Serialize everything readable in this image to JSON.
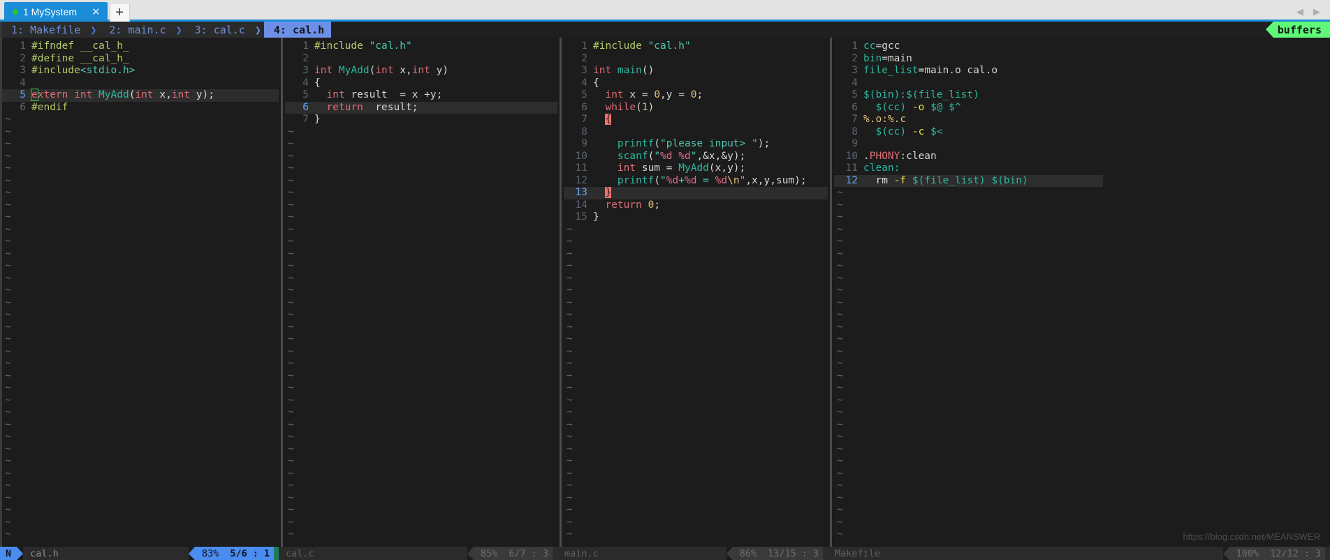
{
  "window": {
    "os_tab": {
      "label": "1 MySystem",
      "number": "1",
      "name": "MySystem",
      "status_dot": "session-active",
      "close_icon": "close-icon",
      "new_tab_icon": "plus-icon"
    },
    "scroll_left_icon": "chevron-left-icon",
    "scroll_right_icon": "chevron-right-icon",
    "accent_color": "#1a8cd8",
    "watermark": "https://blog.csdn.net/MEANSWER"
  },
  "tabline": {
    "tabs": [
      {
        "label": "1: Makefile",
        "active": false
      },
      {
        "label": "2: main.c",
        "active": false
      },
      {
        "label": "3: cal.c",
        "active": false
      },
      {
        "label": "4: cal.h",
        "active": true
      }
    ],
    "separator_glyph": "❯",
    "right_label": "buffers",
    "right_label_color": "#5ff877",
    "active_color": "#6c8fe8"
  },
  "panes": [
    {
      "name": "cal.h",
      "lines": [
        {
          "n": "1",
          "cursor": false,
          "tokens": [
            {
              "t": "#ifndef ",
              "c": "c-pre"
            },
            {
              "t": "__cal_h_",
              "c": "c-pre"
            }
          ]
        },
        {
          "n": "2",
          "cursor": false,
          "tokens": [
            {
              "t": "#define ",
              "c": "c-pre"
            },
            {
              "t": "__cal_h_",
              "c": "c-pre"
            }
          ]
        },
        {
          "n": "3",
          "cursor": false,
          "tokens": [
            {
              "t": "#include",
              "c": "c-pre"
            },
            {
              "t": "<stdio.h>",
              "c": "c-str"
            }
          ]
        },
        {
          "n": "4",
          "cursor": false,
          "tokens": []
        },
        {
          "n": "5",
          "cursor": true,
          "tokens": [
            {
              "t": "e",
              "c": "c-type cursorblk"
            },
            {
              "t": "xtern ",
              "c": "c-type"
            },
            {
              "t": "int ",
              "c": "c-type"
            },
            {
              "t": "MyAdd",
              "c": "c-fn"
            },
            {
              "t": "(",
              "c": "c-punct"
            },
            {
              "t": "int ",
              "c": "c-type"
            },
            {
              "t": "x",
              "c": "c-id"
            },
            {
              "t": ",",
              "c": "c-punct"
            },
            {
              "t": "int ",
              "c": "c-type"
            },
            {
              "t": "y",
              "c": "c-id"
            },
            {
              "t": ");",
              "c": "c-punct"
            }
          ]
        },
        {
          "n": "6",
          "cursor": false,
          "tokens": [
            {
              "t": "#endif",
              "c": "c-pre"
            }
          ]
        }
      ],
      "status": {
        "mode": "N",
        "file": "cal.h",
        "percent": "83%",
        "position": "5/6",
        "separator": ":",
        "column": "1",
        "active": true
      }
    },
    {
      "name": "cal.c",
      "lines": [
        {
          "n": "1",
          "cursor": false,
          "tokens": [
            {
              "t": "#include ",
              "c": "c-pre"
            },
            {
              "t": "\"cal.h\"",
              "c": "c-str"
            }
          ]
        },
        {
          "n": "2",
          "cursor": false,
          "tokens": []
        },
        {
          "n": "3",
          "cursor": false,
          "tokens": [
            {
              "t": "int ",
              "c": "c-type"
            },
            {
              "t": "MyAdd",
              "c": "c-fn"
            },
            {
              "t": "(",
              "c": "c-punct"
            },
            {
              "t": "int ",
              "c": "c-type"
            },
            {
              "t": "x",
              "c": "c-id"
            },
            {
              "t": ",",
              "c": "c-punct"
            },
            {
              "t": "int ",
              "c": "c-type"
            },
            {
              "t": "y",
              "c": "c-id"
            },
            {
              "t": ")",
              "c": "c-punct"
            }
          ]
        },
        {
          "n": "4",
          "cursor": false,
          "tokens": [
            {
              "t": "{",
              "c": "c-brace"
            }
          ]
        },
        {
          "n": "5",
          "cursor": false,
          "tokens": [
            {
              "t": "  ",
              "c": "c-punct"
            },
            {
              "t": "int ",
              "c": "c-type"
            },
            {
              "t": "result  = x +y;",
              "c": "c-id"
            }
          ]
        },
        {
          "n": "6",
          "cursor": true,
          "tokens": [
            {
              "t": "  ",
              "c": "c-punct"
            },
            {
              "t": "return",
              "c": "c-kw"
            },
            {
              "t": "  result;",
              "c": "c-id"
            }
          ]
        },
        {
          "n": "7",
          "cursor": false,
          "tokens": [
            {
              "t": "}",
              "c": "c-brace"
            }
          ]
        }
      ],
      "status": {
        "mode": "",
        "file": "cal.c",
        "percent": "85%",
        "position": "6/7",
        "separator": ":",
        "column": "3",
        "active": false
      }
    },
    {
      "name": "main.c",
      "lines": [
        {
          "n": "1",
          "cursor": false,
          "tokens": [
            {
              "t": "#include ",
              "c": "c-pre"
            },
            {
              "t": "\"cal.h\"",
              "c": "c-str"
            }
          ]
        },
        {
          "n": "2",
          "cursor": false,
          "tokens": []
        },
        {
          "n": "3",
          "cursor": false,
          "tokens": [
            {
              "t": "int ",
              "c": "c-type"
            },
            {
              "t": "main",
              "c": "c-fn"
            },
            {
              "t": "()",
              "c": "c-punct"
            }
          ]
        },
        {
          "n": "4",
          "cursor": false,
          "tokens": [
            {
              "t": "{",
              "c": "c-brace"
            }
          ]
        },
        {
          "n": "5",
          "cursor": false,
          "tokens": [
            {
              "t": "  ",
              "c": "c-punct"
            },
            {
              "t": "int ",
              "c": "c-type"
            },
            {
              "t": "x = ",
              "c": "c-id"
            },
            {
              "t": "0",
              "c": "c-num"
            },
            {
              "t": ",y = ",
              "c": "c-id"
            },
            {
              "t": "0",
              "c": "c-num"
            },
            {
              "t": ";",
              "c": "c-punct"
            }
          ]
        },
        {
          "n": "6",
          "cursor": false,
          "tokens": [
            {
              "t": "  ",
              "c": "c-punct"
            },
            {
              "t": "while",
              "c": "c-kw"
            },
            {
              "t": "(",
              "c": "c-punct"
            },
            {
              "t": "1",
              "c": "c-num"
            },
            {
              "t": ")",
              "c": "c-punct"
            }
          ]
        },
        {
          "n": "7",
          "cursor": false,
          "tokens": [
            {
              "t": "  ",
              "c": "c-punct"
            },
            {
              "t": "{",
              "c": "hl-paren"
            }
          ]
        },
        {
          "n": "8",
          "cursor": false,
          "tokens": []
        },
        {
          "n": "9",
          "cursor": false,
          "tokens": [
            {
              "t": "    ",
              "c": "c-punct"
            },
            {
              "t": "printf",
              "c": "c-fn"
            },
            {
              "t": "(",
              "c": "c-punct"
            },
            {
              "t": "\"please input> \"",
              "c": "c-str"
            },
            {
              "t": ");",
              "c": "c-punct"
            }
          ]
        },
        {
          "n": "10",
          "cursor": false,
          "tokens": [
            {
              "t": "    ",
              "c": "c-punct"
            },
            {
              "t": "scanf",
              "c": "c-fn"
            },
            {
              "t": "(",
              "c": "c-punct"
            },
            {
              "t": "\"",
              "c": "c-str"
            },
            {
              "t": "%d %d",
              "c": "c-fmt"
            },
            {
              "t": "\"",
              "c": "c-str"
            },
            {
              "t": ",&x,&y);",
              "c": "c-id"
            }
          ]
        },
        {
          "n": "11",
          "cursor": false,
          "tokens": [
            {
              "t": "    ",
              "c": "c-punct"
            },
            {
              "t": "int ",
              "c": "c-type"
            },
            {
              "t": "sum = ",
              "c": "c-id"
            },
            {
              "t": "MyAdd",
              "c": "c-fn"
            },
            {
              "t": "(x,y);",
              "c": "c-id"
            }
          ]
        },
        {
          "n": "12",
          "cursor": false,
          "tokens": [
            {
              "t": "    ",
              "c": "c-punct"
            },
            {
              "t": "printf",
              "c": "c-fn"
            },
            {
              "t": "(",
              "c": "c-punct"
            },
            {
              "t": "\"",
              "c": "c-str"
            },
            {
              "t": "%d",
              "c": "c-fmt"
            },
            {
              "t": "+",
              "c": "c-str"
            },
            {
              "t": "%d",
              "c": "c-fmt"
            },
            {
              "t": " = ",
              "c": "c-str"
            },
            {
              "t": "%d",
              "c": "c-fmt"
            },
            {
              "t": "\\n",
              "c": "c-num"
            },
            {
              "t": "\"",
              "c": "c-str"
            },
            {
              "t": ",x,y,sum);",
              "c": "c-id"
            }
          ]
        },
        {
          "n": "13",
          "cursor": true,
          "tokens": [
            {
              "t": "  ",
              "c": "c-punct"
            },
            {
              "t": "}",
              "c": "hl-paren"
            }
          ]
        },
        {
          "n": "14",
          "cursor": false,
          "tokens": [
            {
              "t": "  ",
              "c": "c-punct"
            },
            {
              "t": "return ",
              "c": "c-kw"
            },
            {
              "t": "0",
              "c": "c-num"
            },
            {
              "t": ";",
              "c": "c-punct"
            }
          ]
        },
        {
          "n": "15",
          "cursor": false,
          "tokens": [
            {
              "t": "}",
              "c": "c-brace"
            }
          ]
        }
      ],
      "status": {
        "mode": "",
        "file": "main.c",
        "percent": "86%",
        "position": "13/15",
        "separator": ":",
        "column": "3",
        "active": false
      }
    },
    {
      "name": "Makefile",
      "lines": [
        {
          "n": "1",
          "cursor": false,
          "tokens": [
            {
              "t": "cc",
              "c": "c-var"
            },
            {
              "t": "=",
              "c": "c-id"
            },
            {
              "t": "gcc",
              "c": "c-id"
            }
          ]
        },
        {
          "n": "2",
          "cursor": false,
          "tokens": [
            {
              "t": "bin",
              "c": "c-var"
            },
            {
              "t": "=",
              "c": "c-id"
            },
            {
              "t": "main",
              "c": "c-id"
            }
          ]
        },
        {
          "n": "3",
          "cursor": false,
          "tokens": [
            {
              "t": "file_list",
              "c": "c-var"
            },
            {
              "t": "=",
              "c": "c-id"
            },
            {
              "t": "main.o cal.o",
              "c": "c-id"
            }
          ]
        },
        {
          "n": "4",
          "cursor": false,
          "tokens": []
        },
        {
          "n": "5",
          "cursor": false,
          "tokens": [
            {
              "t": "$(bin):$(file_list)",
              "c": "c-var"
            }
          ]
        },
        {
          "n": "6",
          "cursor": false,
          "tokens": [
            {
              "t": "  ",
              "c": "c-punct"
            },
            {
              "t": "$(cc) ",
              "c": "c-var"
            },
            {
              "t": "-o",
              "c": "c-flag"
            },
            {
              "t": " ",
              "c": "c-id"
            },
            {
              "t": "$@ $^",
              "c": "c-var"
            }
          ]
        },
        {
          "n": "7",
          "cursor": false,
          "tokens": [
            {
              "t": "%.o:%.c",
              "c": "c-target"
            }
          ]
        },
        {
          "n": "8",
          "cursor": false,
          "tokens": [
            {
              "t": "  ",
              "c": "c-punct"
            },
            {
              "t": "$(cc) ",
              "c": "c-var"
            },
            {
              "t": "-c",
              "c": "c-flag"
            },
            {
              "t": " ",
              "c": "c-id"
            },
            {
              "t": "$<",
              "c": "c-var"
            }
          ]
        },
        {
          "n": "9",
          "cursor": false,
          "tokens": []
        },
        {
          "n": "10",
          "cursor": false,
          "tokens": [
            {
              "t": ".",
              "c": "c-id"
            },
            {
              "t": "PHONY",
              "c": "c-phony"
            },
            {
              "t": ":clean",
              "c": "c-id"
            }
          ]
        },
        {
          "n": "11",
          "cursor": false,
          "tokens": [
            {
              "t": "clean:",
              "c": "c-var"
            }
          ]
        },
        {
          "n": "12",
          "cursor": true,
          "tokens": [
            {
              "t": "  ",
              "c": "c-punct"
            },
            {
              "t": "rm ",
              "c": "c-id"
            },
            {
              "t": "-f",
              "c": "c-flag"
            },
            {
              "t": " ",
              "c": "c-id"
            },
            {
              "t": "$(file_list) $(bin)",
              "c": "c-var"
            }
          ]
        }
      ],
      "status": {
        "mode": "",
        "file": "Makefile",
        "percent": "100%",
        "position": "12/12",
        "separator": ":",
        "column": "3",
        "active": false
      }
    }
  ]
}
